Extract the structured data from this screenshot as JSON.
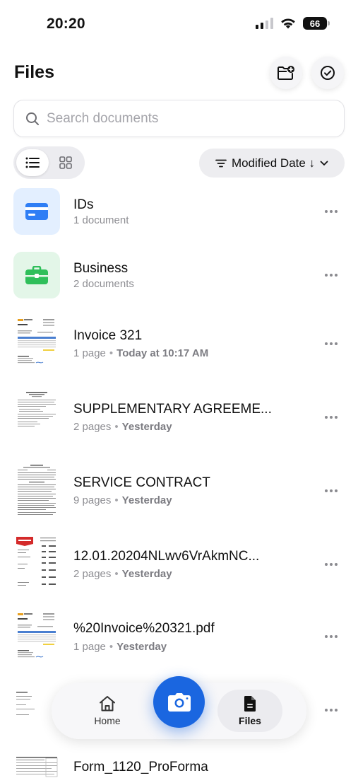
{
  "status_bar": {
    "time": "20:20",
    "battery": "66"
  },
  "header": {
    "title": "Files"
  },
  "search": {
    "placeholder": "Search documents"
  },
  "sort": {
    "label": "Modified Date ↓"
  },
  "items": [
    {
      "name": "IDs",
      "meta": "1 document",
      "type": "folder",
      "color": "#e3efff",
      "icon": "id-card-icon"
    },
    {
      "name": "Business",
      "meta": "2 documents",
      "type": "folder",
      "color": "#e3f6e8",
      "icon": "briefcase-icon"
    },
    {
      "name": "Invoice 321",
      "pages": "1 page",
      "date": "Today at 10:17 AM",
      "type": "document"
    },
    {
      "name": "SUPPLEMENTARY AGREEME...",
      "pages": "2 pages",
      "date": "Yesterday",
      "type": "document"
    },
    {
      "name": "SERVICE CONTRACT",
      "pages": "9 pages",
      "date": "Yesterday",
      "type": "document"
    },
    {
      "name": "12.01.20204NLwv6VrAkmNC...",
      "pages": "2 pages",
      "date": "Yesterday",
      "type": "document"
    },
    {
      "name": "%20Invoice%20321.pdf",
      "pages": "1 page",
      "date": "Yesterday",
      "type": "document"
    },
    {
      "name": "Form_1120_ProForma",
      "type": "document"
    }
  ],
  "tabbar": {
    "home_label": "Home",
    "files_label": "Files"
  },
  "colors": {
    "accent": "#1a66e0",
    "folder_ids": "#2f7ef5",
    "folder_business": "#2fbf5a"
  }
}
